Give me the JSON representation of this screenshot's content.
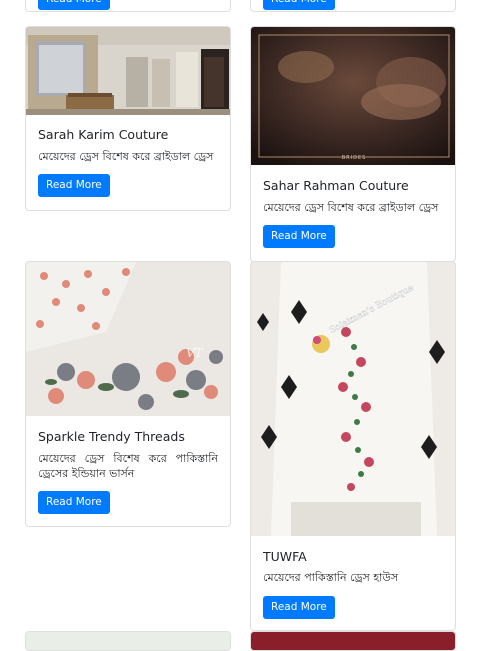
{
  "read_more_label": "Read More",
  "colors": {
    "primary": "#007bff",
    "card_border": "#dee2e6"
  },
  "cards": [
    {
      "title": "Sarah Karim Couture",
      "description": "মেয়েদের ড্রেস বিশেষ করে ব্রাইডাল ড্রেস"
    },
    {
      "title": "Sahar Rahman Couture",
      "description": "মেয়েদের ড্রেস বিশেষ করে ব্রাইডাল ড্রেস",
      "image_caption": "BRIDES"
    },
    {
      "title": "Sparkle Trendy Threads",
      "description": "মেয়েদের ড্রেস বিশেষ করে পাকিস্তানি ড্রেসের ইন্ডিয়ান ভার্সন"
    },
    {
      "title": "TUWFA",
      "description": "মেয়েদের পাকিস্তানি ড্রেস হাউস",
      "image_watermark": "Solaiman's Boutique"
    }
  ]
}
